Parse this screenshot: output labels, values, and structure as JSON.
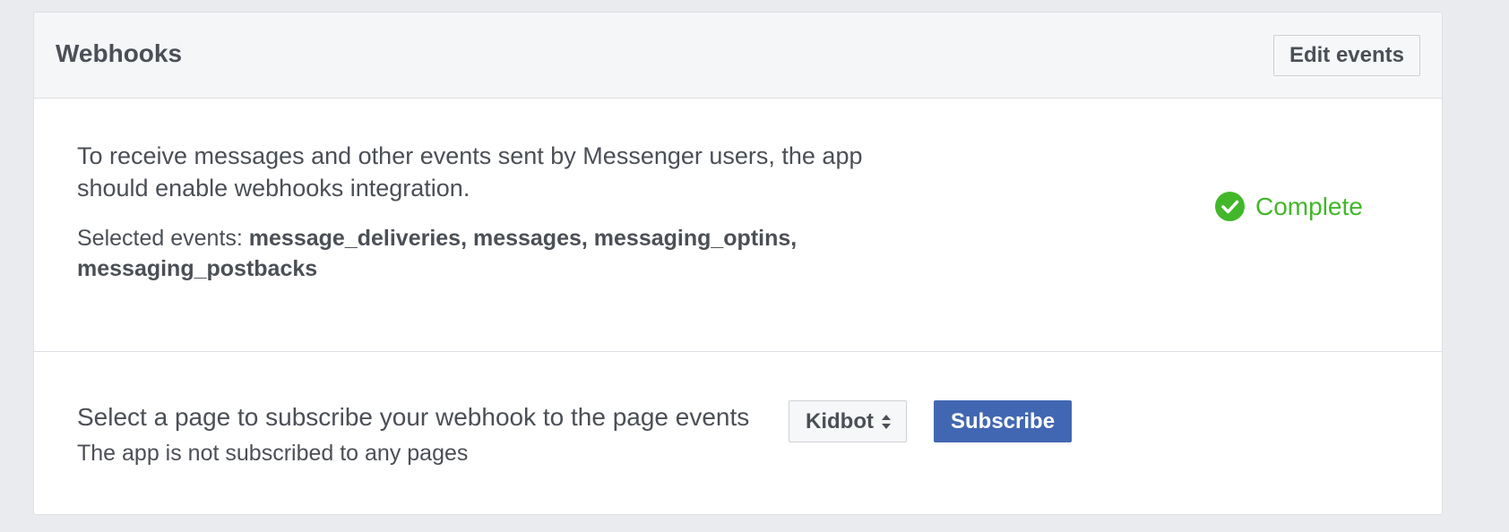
{
  "webhooks": {
    "title": "Webhooks",
    "edit_events_label": "Edit events"
  },
  "integration": {
    "description": "To receive messages and other events sent by Messenger users, the app should enable webhooks integration.",
    "selected_events_label": "Selected events:",
    "selected_events_value": "message_deliveries, messages, messaging_optins, messaging_postbacks",
    "status_text": "Complete",
    "status_icon": "check-circle-icon",
    "status_color": "#42b72a"
  },
  "subscription": {
    "prompt": "Select a page to subscribe your webhook to the page events",
    "status_text": "The app is not subscribed to any pages",
    "page_select_value": "Kidbot",
    "subscribe_label": "Subscribe",
    "subscribe_color": "#4267b2"
  }
}
